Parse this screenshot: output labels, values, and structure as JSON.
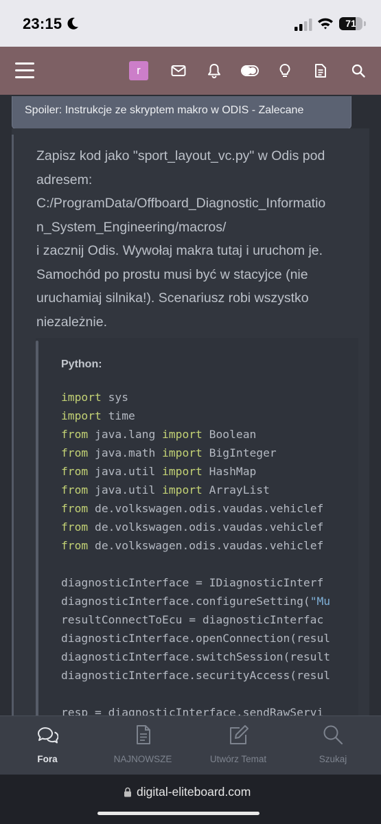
{
  "status_bar": {
    "time": "23:15",
    "battery_level": 71,
    "battery_label": "71"
  },
  "header": {
    "avatar_initial": "r",
    "icons": [
      "menu-icon",
      "mail-icon",
      "bell-icon",
      "toggle-icon",
      "lightbulb-icon",
      "document-icon",
      "search-icon"
    ]
  },
  "spoiler": {
    "label": "Spoiler: Instrukcje ze skryptem makro w ODIS - Zalecane"
  },
  "post": {
    "lines": [
      "Zapisz kod jako \"sport_layout_vc.py\" w Odis pod",
      "adresem:",
      "C:/ProgramData/Offboard_Diagnostic_Informatio",
      "n_System_Engineering/macros/",
      "i zacznij Odis. Wywołaj makra tutaj i uruchom je.",
      "Samochód po prostu musi być w stacyjce (nie",
      "uruchamiaj silnika!). Scenariusz robi wszystko",
      "niezależnie."
    ]
  },
  "code": {
    "title": "Python:",
    "lines": [
      [
        {
          "t": "import",
          "k": "kw"
        },
        {
          "t": " sys"
        }
      ],
      [
        {
          "t": "import",
          "k": "kw"
        },
        {
          "t": " time"
        }
      ],
      [
        {
          "t": "from",
          "k": "kw"
        },
        {
          "t": " java.lang "
        },
        {
          "t": "import",
          "k": "kw"
        },
        {
          "t": " Boolean"
        }
      ],
      [
        {
          "t": "from",
          "k": "kw"
        },
        {
          "t": " java.math "
        },
        {
          "t": "import",
          "k": "kw"
        },
        {
          "t": " BigInteger"
        }
      ],
      [
        {
          "t": "from",
          "k": "kw"
        },
        {
          "t": " java.util "
        },
        {
          "t": "import",
          "k": "kw"
        },
        {
          "t": " HashMap"
        }
      ],
      [
        {
          "t": "from",
          "k": "kw"
        },
        {
          "t": " java.util "
        },
        {
          "t": "import",
          "k": "kw"
        },
        {
          "t": " ArrayList"
        }
      ],
      [
        {
          "t": "from",
          "k": "kw"
        },
        {
          "t": " de.volkswagen.odis.vaudas.vehiclef"
        }
      ],
      [
        {
          "t": "from",
          "k": "kw"
        },
        {
          "t": " de.volkswagen.odis.vaudas.vehiclef"
        }
      ],
      [
        {
          "t": "from",
          "k": "kw"
        },
        {
          "t": " de.volkswagen.odis.vaudas.vehiclef"
        }
      ],
      [],
      [
        {
          "t": "diagnosticInterface = IDiagnosticInterf"
        }
      ],
      [
        {
          "t": "diagnosticInterface.configureSetting("
        },
        {
          "t": "\"Mu",
          "k": "str"
        }
      ],
      [
        {
          "t": "resultConnectToEcu = diagnosticInterfac"
        }
      ],
      [
        {
          "t": "diagnosticInterface.openConnection(resul"
        }
      ],
      [
        {
          "t": "diagnosticInterface.switchSession(result"
        }
      ],
      [
        {
          "t": "diagnosticInterface.securityAccess(resul"
        }
      ],
      [],
      [
        {
          "t": "resp = diagnosticInterface.sendRawServi"
        }
      ]
    ]
  },
  "tabs": [
    {
      "label": "Fora",
      "icon": "forums-icon",
      "active": true
    },
    {
      "label": "NAJNOWSZE",
      "icon": "whats-new-icon",
      "active": false
    },
    {
      "label": "Utwórz Temat",
      "icon": "compose-icon",
      "active": false
    },
    {
      "label": "Szukaj",
      "icon": "search-icon",
      "active": false
    }
  ],
  "browser": {
    "url": "digital-eliteboard.com"
  }
}
